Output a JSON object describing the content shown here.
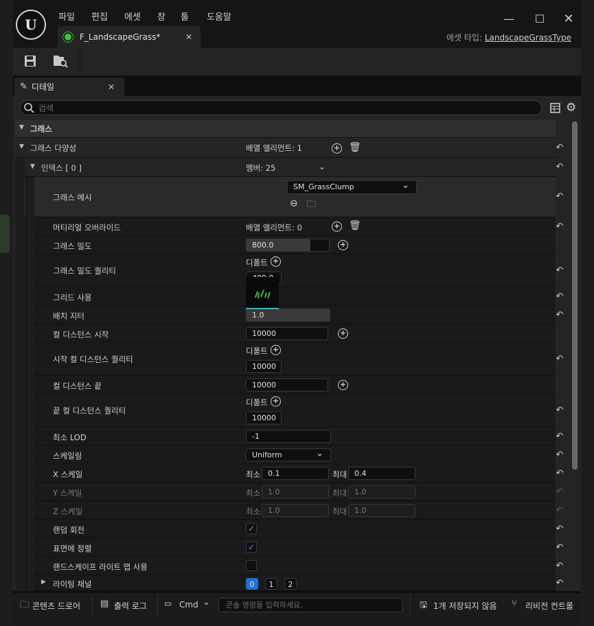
{
  "menu": [
    "파일",
    "편집",
    "에셋",
    "창",
    "툴",
    "도움말"
  ],
  "doc_tab": {
    "title": "F_LandscapeGrass*"
  },
  "asset_type": {
    "label": "에셋 타입:",
    "value": "LandscapeGrassType"
  },
  "panel_tab": {
    "title": "디테일"
  },
  "search": {
    "placeholder": "검색"
  },
  "category": "그래스",
  "grass_varieties": {
    "label": "그래스 다양성",
    "value": "배열 엘리먼트: 1"
  },
  "index": {
    "label": "인덱스 [ 0 ]",
    "value": "멤버: 25"
  },
  "grass_mesh": {
    "label": "그래스 메시",
    "value": "SM_GrassClump"
  },
  "material_overrides": {
    "label": "머티리얼 오버라이드",
    "value": "배열 엘리먼트: 0"
  },
  "grass_density": {
    "label": "그래스 밀도",
    "value": "800.0"
  },
  "grass_density_quality": {
    "label": "그래스 밀도 퀄리티",
    "default_label": "디폴트",
    "value": "400.0"
  },
  "use_grid": {
    "label": "그리드 사용",
    "checked": true
  },
  "placement_jitter": {
    "label": "배치 지터",
    "value": "1.0"
  },
  "cull_start": {
    "label": "컬 디스턴스 시작",
    "value": "10000"
  },
  "cull_start_quality": {
    "label": "시작 컬 디스턴스 퀄리티",
    "default_label": "디폴트",
    "value": "10000"
  },
  "cull_end": {
    "label": "컬 디스턴스 끝",
    "value": "10000"
  },
  "cull_end_quality": {
    "label": "끝 컬 디스턴스 퀄리티",
    "default_label": "디폴트",
    "value": "10000"
  },
  "min_lod": {
    "label": "최소 LOD",
    "value": "-1"
  },
  "scaling": {
    "label": "스케일링",
    "value": "Uniform"
  },
  "scale_x": {
    "label": "X 스케일",
    "min_label": "최소",
    "min": "0.1",
    "max_label": "최대",
    "max": "0.4"
  },
  "scale_y": {
    "label": "Y 스케일",
    "min_label": "최소",
    "min": "1.0",
    "max_label": "최대",
    "max": "1.0"
  },
  "scale_z": {
    "label": "Z 스케일",
    "min_label": "최소",
    "min": "1.0",
    "max_label": "최대",
    "max": "1.0"
  },
  "random_rotation": {
    "label": "랜덤 회전",
    "checked": true
  },
  "align_to_surface": {
    "label": "표면에 정렬",
    "checked": true
  },
  "use_landscape_lightmap": {
    "label": "랜드스케이프 라이트 맵 사용",
    "checked": false
  },
  "lighting_channels": {
    "label": "라이팅 채널",
    "channels": [
      "0",
      "1",
      "2"
    ],
    "active": "0"
  },
  "statusbar": {
    "content_drawer": "콘텐츠 드로어",
    "output_log": "출력 로그",
    "cmd": "Cmd",
    "console_placeholder": "콘솔 명령을 입력하세요.",
    "unsaved": "1개 저장되지 않음",
    "revision": "리비전 컨트롤"
  },
  "colors": {
    "accent": "#1f6fd6",
    "check": "#3c9cff",
    "mesh_underline": "#19c5cc"
  }
}
